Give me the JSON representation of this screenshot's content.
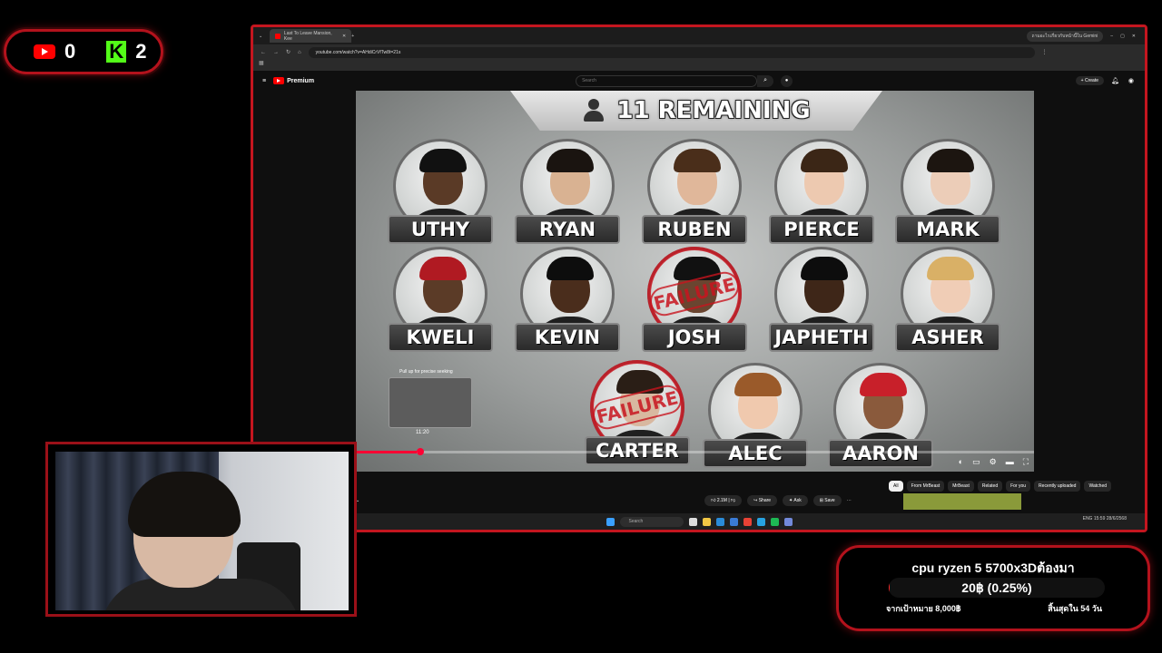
{
  "counter": {
    "youtube_count": "0",
    "kick_logo": "K",
    "kick_count": "2"
  },
  "browser": {
    "tab_title": "Last To Leave Mansion, Kee",
    "gemini_label": "ถามอะไรเกี่ยวกับหน้านี้ใน Gemini",
    "url": "youtube.com/watch?v=AHdiCrVfTw8t=21s"
  },
  "youtube": {
    "brand": "Premium",
    "search_placeholder": "Search",
    "create_label": "+ Create",
    "video": {
      "banner_text": "11 REMAINING",
      "contestants": [
        {
          "name": "UTHY",
          "failure": false,
          "skin": "#5a3a26",
          "hair": "#111"
        },
        {
          "name": "RYAN",
          "failure": false,
          "skin": "#d9b292",
          "hair": "#1a1410"
        },
        {
          "name": "RUBEN",
          "failure": false,
          "skin": "#e0b79a",
          "hair": "#4a2e1a"
        },
        {
          "name": "PIERCE",
          "failure": false,
          "skin": "#edc9b0",
          "hair": "#3b2616"
        },
        {
          "name": "MARK",
          "failure": false,
          "skin": "#eccdb8",
          "hair": "#1c1510"
        },
        {
          "name": "KWELI",
          "failure": false,
          "skin": "#5b3b27",
          "hair": "#b01a22"
        },
        {
          "name": "KEVIN",
          "failure": false,
          "skin": "#4a2d1c",
          "hair": "#0d0d0d"
        },
        {
          "name": "JOSH",
          "failure": true,
          "stamp": "FAILURE",
          "skin": "#6a4530",
          "hair": "#111"
        },
        {
          "name": "JAPHETH",
          "failure": false,
          "skin": "#3e2618",
          "hair": "#0d0d0d"
        },
        {
          "name": "ASHER",
          "failure": false,
          "skin": "#f0cdb6",
          "hair": "#d9b066"
        },
        {
          "name": "CARTER",
          "failure": true,
          "stamp": "FAILURE",
          "skin": "#d8b8a0",
          "hair": "#2a1e16"
        },
        {
          "name": "ALEC",
          "failure": false,
          "skin": "#f0c9ae",
          "hair": "#9a5a2a"
        },
        {
          "name": "AARON",
          "failure": false,
          "skin": "#8a5a3c",
          "hair": "#c8202a"
        }
      ],
      "hover_tip": "Pull up for precise seeking",
      "hover_time": "11:20",
      "progress": 0.09
    },
    "actions": {
      "likes": "2.1M",
      "share": "Share",
      "ask": "Ask",
      "save": "Save"
    },
    "chips": [
      "All",
      "From MrBeast",
      "MrBeast",
      "Related",
      "For you",
      "Recently uploaded",
      "Watched"
    ]
  },
  "taskbar": {
    "search": "Search",
    "lang": "ENG",
    "time": "15:59",
    "date": "28/6/2568"
  },
  "goal": {
    "title": "cpu ryzen 5 5700x3Dต้องมา",
    "amount": "20฿ (0.25%)",
    "fraction": 0.0025,
    "target": "จากเป้าหมาย 8,000฿",
    "ends": "สิ้นสุดใน 54 วัน"
  },
  "colors": {
    "accent": "#c4161f",
    "youtube_red": "#ff0000",
    "kick_green": "#53fc18"
  }
}
